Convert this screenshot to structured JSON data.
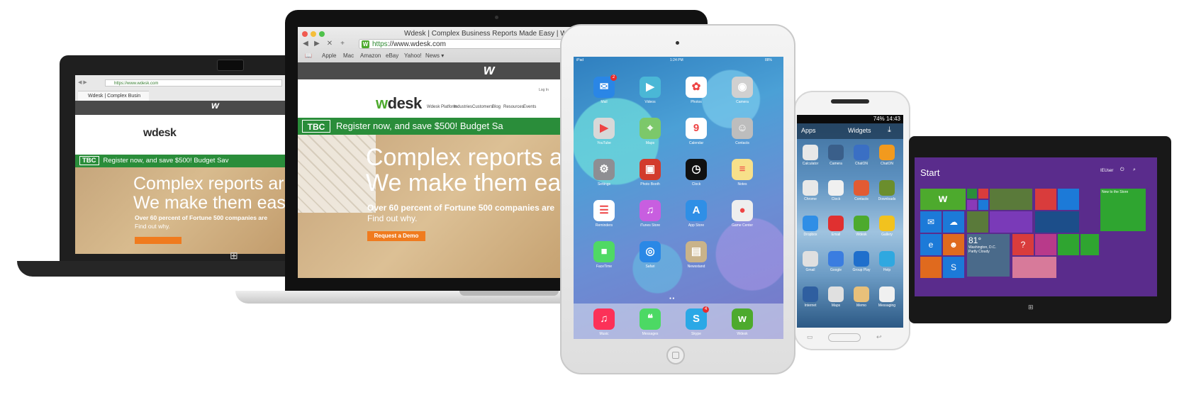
{
  "winlaptop": {
    "url": "https://www.wdesk.com",
    "tab": "Wdesk | Complex Busin",
    "logo": "wdesk",
    "banner": "Register now, and save $500! Budget Sav",
    "hero_line1": "Complex reports ar",
    "hero_line2": "We make them eas",
    "hero_sub": "Over 60 percent of Fortune 500 companies are",
    "hero_sub2": "Find out why."
  },
  "mac": {
    "window_title": "Wdesk | Complex Business Reports Made Easy | WebFiling",
    "url_scheme": "https",
    "url_rest": "://www.wdesk.com",
    "bookmarks": [
      "Apple",
      "Mac",
      "Amazon",
      "eBay",
      "Yahoo!",
      "News ▾"
    ],
    "login": "Log In",
    "logo_w": "w",
    "logo_rest": "desk",
    "menu": [
      "Wdesk Platform",
      "Industries",
      "Customers",
      "Blog",
      "Resources",
      "Events"
    ],
    "tbc": "TBC",
    "banner": "Register now, and save $500! Budget Sa",
    "hero_line1": "Complex reports a",
    "hero_line2": "We make them eas",
    "hero_sub": "Over 60 percent of Fortune 500 companies are",
    "hero_sub2": "Find out why.",
    "cta": "Request a Demo"
  },
  "ipad": {
    "status_left": "iPad",
    "status_time": "1:24 PM",
    "status_right": "88%",
    "apps": [
      {
        "label": "Mail",
        "color": "#2a86e6",
        "glyph": "✉",
        "badge": "2"
      },
      {
        "label": "Videos",
        "color": "#4ab7d6",
        "glyph": "▶"
      },
      {
        "label": "Photos",
        "color": "#ffffff",
        "glyph": "✿"
      },
      {
        "label": "Camera",
        "color": "#d0d0d0",
        "glyph": "◉"
      },
      {
        "label": "YouTube",
        "color": "#d8d8d8",
        "glyph": "▶"
      },
      {
        "label": "Maps",
        "color": "#7cc86a",
        "glyph": "⌖"
      },
      {
        "label": "Calendar",
        "color": "#ffffff",
        "glyph": "9"
      },
      {
        "label": "Contacts",
        "color": "#bdbdbd",
        "glyph": "☺"
      },
      {
        "label": "Settings",
        "color": "#8e8e93",
        "glyph": "⚙"
      },
      {
        "label": "Photo Booth",
        "color": "#d23b2c",
        "glyph": "▣"
      },
      {
        "label": "Clock",
        "color": "#111111",
        "glyph": "◷"
      },
      {
        "label": "Notes",
        "color": "#f7e08a",
        "glyph": "≡"
      },
      {
        "label": "Reminders",
        "color": "#ffffff",
        "glyph": "☰"
      },
      {
        "label": "iTunes Store",
        "color": "#c85ee0",
        "glyph": "♫"
      },
      {
        "label": "App Store",
        "color": "#2f8fe6",
        "glyph": "A"
      },
      {
        "label": "Game Center",
        "color": "#eeeeee",
        "glyph": "●"
      },
      {
        "label": "FaceTime",
        "color": "#4fd964",
        "glyph": "■"
      },
      {
        "label": "Safari",
        "color": "#2a88e6",
        "glyph": "◎"
      },
      {
        "label": "Newsstand",
        "color": "#c9b38a",
        "glyph": "▤"
      }
    ],
    "dock": [
      {
        "label": "Music",
        "color": "#fc3158",
        "glyph": "♫"
      },
      {
        "label": "Messages",
        "color": "#4cd964",
        "glyph": "❝"
      },
      {
        "label": "Skype",
        "color": "#2aa8e6",
        "glyph": "S",
        "badge": "4"
      },
      {
        "label": "Wdesk",
        "color": "#4daa2d",
        "glyph": "w"
      }
    ]
  },
  "samsung": {
    "status_time": "74% 14:43",
    "tabs": [
      "Apps",
      "Widgets"
    ],
    "apps": [
      {
        "label": "Calculator",
        "color": "#e8e8e8"
      },
      {
        "label": "Camera",
        "color": "#3a5f8a"
      },
      {
        "label": "ChatON",
        "color": "#3a6fc4"
      },
      {
        "label": "ChatON",
        "color": "#f29a1e"
      },
      {
        "label": "Chrome",
        "color": "#e8e8e8"
      },
      {
        "label": "Clock",
        "color": "#f0f0f0"
      },
      {
        "label": "Contacts",
        "color": "#e25b33"
      },
      {
        "label": "Downloads",
        "color": "#6b8e2d"
      },
      {
        "label": "Dropbox",
        "color": "#2f8ee6"
      },
      {
        "label": "Email",
        "color": "#e03030"
      },
      {
        "label": "Wdesk",
        "color": "#4daa2d"
      },
      {
        "label": "Gallery",
        "color": "#f2c21e"
      },
      {
        "label": "Gmail",
        "color": "#e0e0e0"
      },
      {
        "label": "Google",
        "color": "#3b7de0"
      },
      {
        "label": "Group Play",
        "color": "#1f6fcc"
      },
      {
        "label": "Help",
        "color": "#2fa8e0"
      },
      {
        "label": "Internet",
        "color": "#2f5fa0"
      },
      {
        "label": "Maps",
        "color": "#e0e0e0"
      },
      {
        "label": "Memo",
        "color": "#e8c07a"
      },
      {
        "label": "Messaging",
        "color": "#f0f0f0"
      }
    ]
  },
  "surface": {
    "start": "Start",
    "user": "IEUser",
    "weather_temp": "81°",
    "weather_city": "Washington, D.C.",
    "weather_desc": "Partly Cloudy",
    "store": "New to the Store"
  },
  "colors": {
    "wdesk_green": "#2a8d3a",
    "cta_orange": "#f07b1e"
  }
}
